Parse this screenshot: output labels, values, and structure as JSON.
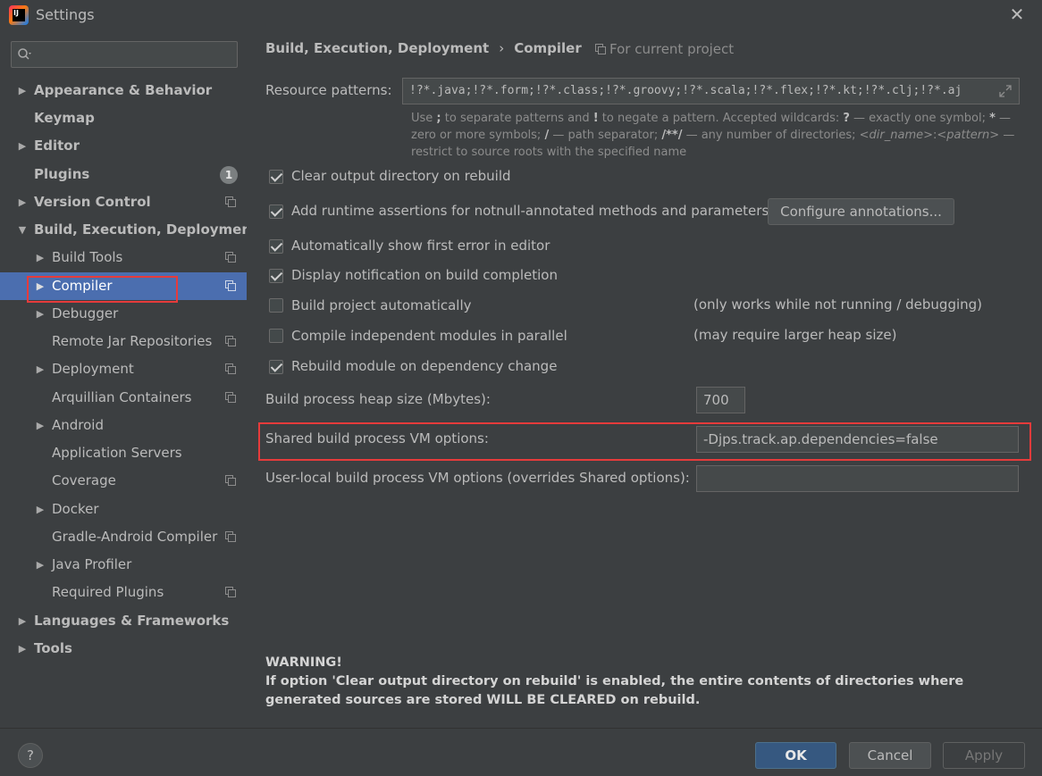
{
  "window": {
    "title": "Settings",
    "app_icon_text": "IJ"
  },
  "sidebar": {
    "search_placeholder": "",
    "items": [
      {
        "label": "Appearance & Behavior",
        "bold": true,
        "arrow": "▶"
      },
      {
        "label": "Keymap",
        "bold": true,
        "arrow": ""
      },
      {
        "label": "Editor",
        "bold": true,
        "arrow": "▶"
      },
      {
        "label": "Plugins",
        "bold": true,
        "arrow": "",
        "badge": "1"
      },
      {
        "label": "Version Control",
        "bold": true,
        "arrow": "▶"
      },
      {
        "label": "Build, Execution, Deployment",
        "bold": true,
        "arrow": "▼"
      },
      {
        "label": "Build Tools",
        "arrow": "▶"
      },
      {
        "label": "Compiler",
        "arrow": "▶",
        "selected": true
      },
      {
        "label": "Debugger",
        "arrow": "▶"
      },
      {
        "label": "Remote Jar Repositories",
        "arrow": ""
      },
      {
        "label": "Deployment",
        "arrow": "▶"
      },
      {
        "label": "Arquillian Containers",
        "arrow": ""
      },
      {
        "label": "Android",
        "arrow": "▶"
      },
      {
        "label": "Application Servers",
        "arrow": ""
      },
      {
        "label": "Coverage",
        "arrow": ""
      },
      {
        "label": "Docker",
        "arrow": "▶"
      },
      {
        "label": "Gradle-Android Compiler",
        "arrow": ""
      },
      {
        "label": "Java Profiler",
        "arrow": "▶"
      },
      {
        "label": "Required Plugins",
        "arrow": ""
      },
      {
        "label": "Languages & Frameworks",
        "bold": true,
        "arrow": "▶"
      },
      {
        "label": "Tools",
        "bold": true,
        "arrow": "▶"
      }
    ]
  },
  "content": {
    "breadcrumb": {
      "parent": "Build, Execution, Deployment",
      "separator": "›",
      "current": "Compiler"
    },
    "for_project": "For current project",
    "resource_patterns": {
      "label": "Resource patterns:",
      "value": "!?*.java;!?*.form;!?*.class;!?*.groovy;!?*.scala;!?*.flex;!?*.kt;!?*.clj;!?*.aj"
    },
    "hint": {
      "p1": "Use ",
      "p2": ";",
      "p3": " to separate patterns and ",
      "p4": "!",
      "p5": " to negate a pattern. Accepted wildcards: ",
      "p6": "?",
      "p7": " — exactly one symbol; ",
      "p8": "*",
      "p9": " — zero or more symbols; ",
      "p10": "/",
      "p11": " — path separator; ",
      "p12": "/**/",
      "p13": " — any number of directories; ",
      "p14": "<dir_name>",
      "p15": ":",
      "p16": "<pattern>",
      "p17": " — restrict to source roots with the specified name"
    },
    "options": {
      "clear_output": {
        "label": "Clear output directory on rebuild",
        "checked": true
      },
      "runtime_assertions": {
        "label": "Add runtime assertions for notnull-annotated methods and parameters",
        "checked": true
      },
      "configure_annotations": "Configure annotations...",
      "show_first_error": {
        "label": "Automatically show first error in editor",
        "checked": true
      },
      "display_notification": {
        "label": "Display notification on build completion",
        "checked": true
      },
      "build_automatically": {
        "label": "Build project automatically",
        "checked": false,
        "note": "(only works while not running / debugging)"
      },
      "compile_parallel": {
        "label": "Compile independent modules in parallel",
        "checked": false,
        "note": "(may require larger heap size)"
      },
      "rebuild_on_dependency": {
        "label": "Rebuild module on dependency change",
        "checked": true
      }
    },
    "heap_size": {
      "label": "Build process heap size (Mbytes):",
      "value": "700"
    },
    "shared_vm": {
      "label": "Shared build process VM options:",
      "value": "-Djps.track.ap.dependencies=false"
    },
    "user_vm": {
      "label": "User-local build process VM options (overrides Shared options):",
      "value": ""
    },
    "warning": {
      "title": "WARNING!",
      "body": "If option 'Clear output directory on rebuild' is enabled, the entire contents of directories where generated sources are stored WILL BE CLEARED on rebuild."
    }
  },
  "footer": {
    "help": "?",
    "ok": "OK",
    "cancel": "Cancel",
    "apply": "Apply"
  }
}
